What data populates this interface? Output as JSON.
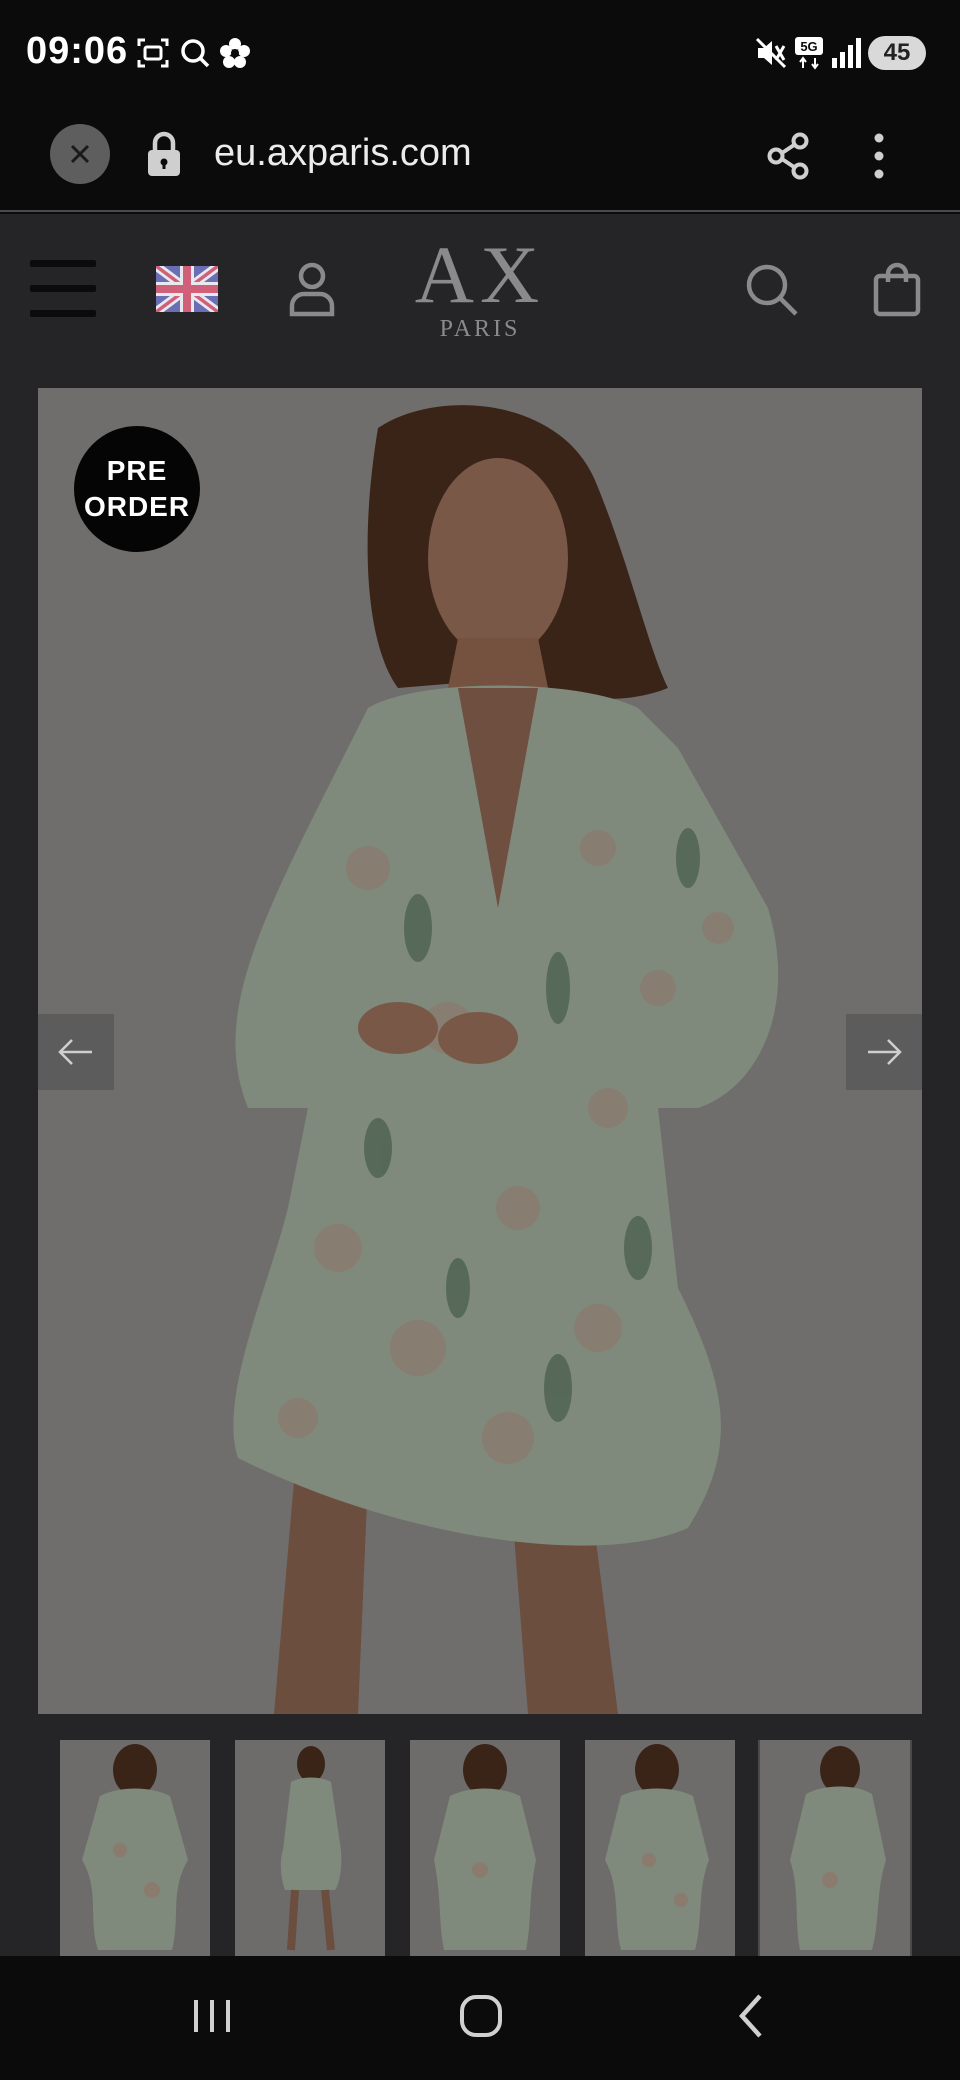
{
  "status_bar": {
    "time": "09:06",
    "battery": "45",
    "icons": [
      "screenshot-icon",
      "search-icon",
      "flower-icon",
      "mute-icon",
      "5g-icon",
      "signal-icon"
    ]
  },
  "browser": {
    "url": "eu.axparis.com",
    "icons": [
      "close-icon",
      "lock-icon",
      "share-icon",
      "more-vert-icon"
    ]
  },
  "site_header": {
    "logo_main": "AX",
    "logo_sub": "PARIS",
    "icons": [
      "menu-icon",
      "uk-flag-icon",
      "account-icon",
      "search-icon",
      "bag-icon"
    ]
  },
  "product": {
    "badge_line1": "PRE",
    "badge_line2": "ORDER",
    "thumbnail_count": 5,
    "active_thumbnail": 5,
    "colors": {
      "dress_sage": "#9fb3a0",
      "background_dim": "#6f6e6c"
    }
  },
  "system_nav": {
    "icons": [
      "recent-apps-icon",
      "home-icon",
      "back-icon"
    ]
  }
}
